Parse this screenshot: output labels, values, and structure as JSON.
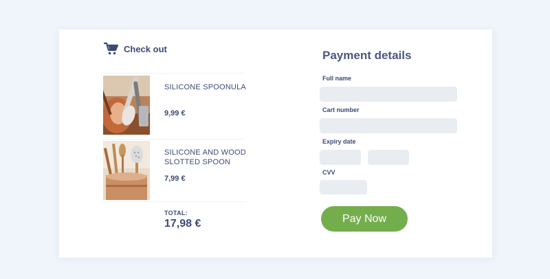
{
  "checkout": {
    "title": "Check out",
    "cart_icon": "shopping-cart-icon",
    "items": [
      {
        "name": "SILICONE SPOONULA",
        "price": "9,99 €",
        "image": "kitchen-utensils-photo"
      },
      {
        "name": "SILICONE AND WOOD SLOTTED SPOON",
        "price": "7,99 €",
        "image": "wooden-spoons-photo"
      }
    ],
    "total_label": "TOTAL:",
    "total_value": "17,98 €"
  },
  "payment": {
    "title": "Payment details",
    "full_name_label": "Full name",
    "full_name_value": "",
    "card_number_label": "Cart number",
    "card_number_value": "",
    "expiry_label": "Expiry date",
    "expiry_month_value": "",
    "expiry_year_value": "",
    "cvv_label": "CVV",
    "cvv_value": "",
    "pay_button": "Pay Now"
  },
  "colors": {
    "background": "#f0f4fb",
    "text": "#3d4a74",
    "input_fill": "#e9edf2",
    "pay_button": "#74ad4c"
  }
}
